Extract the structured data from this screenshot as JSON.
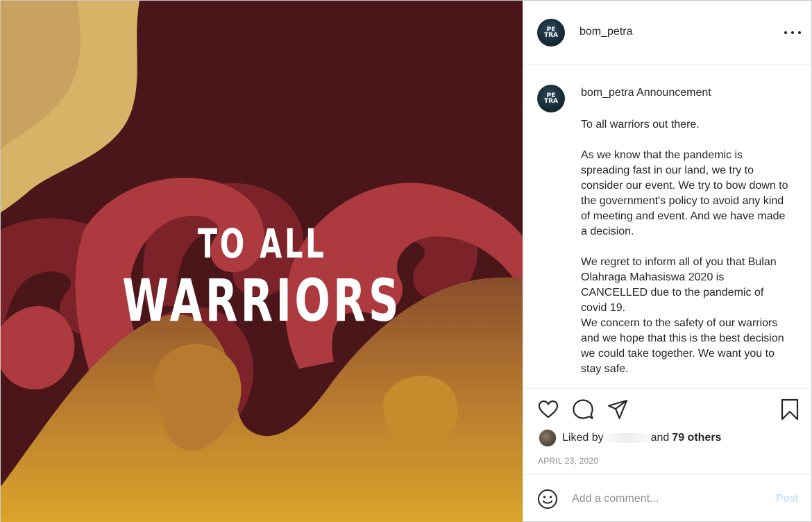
{
  "post": {
    "image": {
      "alt": "",
      "line1": "TO ALL",
      "line2": "WARRIORS",
      "colors": {
        "background": "#4a1619",
        "sand": "#e3c47a",
        "red_dark": "#7c2329",
        "red_light": "#ad3a3e",
        "gold": "#d2a02d"
      }
    },
    "header": {
      "username": "bom_petra",
      "avatar_monogram_top": "PE",
      "avatar_monogram_bottom": "TRA",
      "more_icon": "more-horizontal-icon"
    },
    "caption": {
      "username": "bom_petra",
      "first_word": "Announcement",
      "body": "To all warriors out there.\n\nAs we know that the pandemic is spreading fast in our land, we try to consider our event. We try to bow down to the government's policy to avoid any kind of meeting and event. And we have made a decision.\n\nWe regret to inform all of you that Bulan Olahraga Mahasiswa 2020 is CANCELLED due to the pandemic of covid 19.\nWe concern to the safety of our warriors and we hope that this is the best decision we could take together. We want you to stay safe."
    },
    "actions": {
      "icons": [
        "heart-icon",
        "comment-icon",
        "share-icon",
        "bookmark-icon"
      ]
    },
    "likes": {
      "prefix": "Liked by",
      "conjunction": "and",
      "others": "79 others"
    },
    "date": "APRIL 23, 2020",
    "comment": {
      "placeholder": "Add a comment...",
      "post_label": "Post",
      "post_color": "#b3dbff"
    }
  }
}
